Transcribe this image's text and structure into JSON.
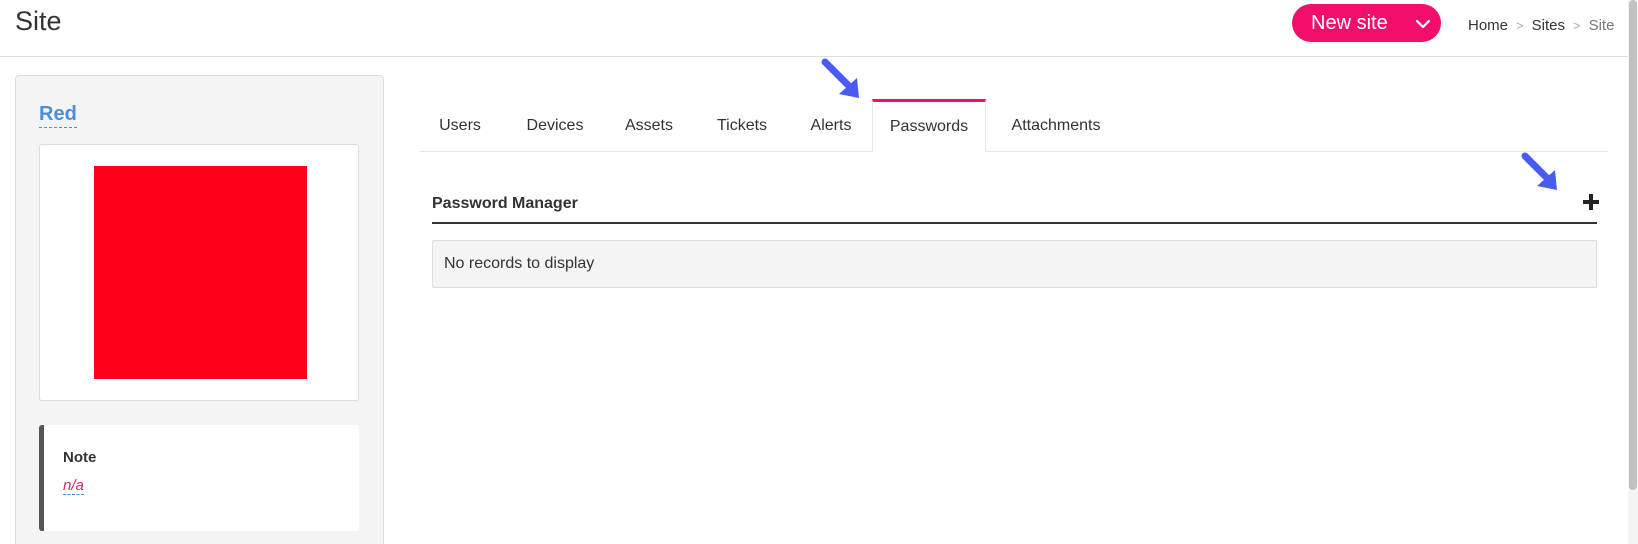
{
  "header": {
    "title": "Site",
    "new_button_label": "New site",
    "caret_icon": "chevron-down-icon",
    "breadcrumb": [
      "Home",
      "Sites",
      "Site"
    ],
    "breadcrumb_separator": ">"
  },
  "site": {
    "name": "Red",
    "image_color": "#ff001a",
    "note_title": "Note",
    "note_value": "n/a"
  },
  "tabs": [
    {
      "label": "Users",
      "active": false
    },
    {
      "label": "Devices",
      "active": false
    },
    {
      "label": "Assets",
      "active": false
    },
    {
      "label": "Tickets",
      "active": false
    },
    {
      "label": "Alerts",
      "active": false
    },
    {
      "label": "Passwords",
      "active": true
    },
    {
      "label": "Attachments",
      "active": false
    }
  ],
  "password_manager": {
    "title": "Password Manager",
    "add_icon": "plus-icon",
    "empty_message": "No records to display"
  },
  "colors": {
    "accent": "#f20f6b",
    "link": "#4a90d9",
    "annotation_arrow": "#4a5cf0"
  }
}
